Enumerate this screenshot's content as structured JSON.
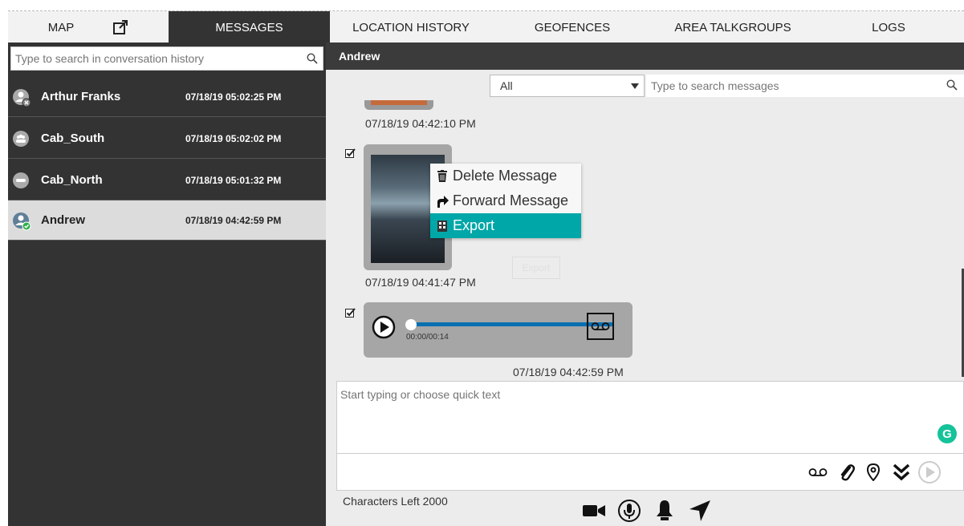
{
  "tabs": {
    "map": "MAP",
    "messages": "MESSAGES",
    "location_history": "LOCATION HISTORY",
    "geofences": "GEOFENCES",
    "area_talkgroups": "AREA TALKGROUPS",
    "logs": "LOGS"
  },
  "sidebar": {
    "search_placeholder": "Type to search in conversation history",
    "conversations": [
      {
        "name": "Arthur Franks",
        "time": "07/18/19 05:02:25 PM"
      },
      {
        "name": "Cab_South",
        "time": "07/18/19 05:02:02 PM"
      },
      {
        "name": "Cab_North",
        "time": "07/18/19 05:01:32 PM"
      },
      {
        "name": "Andrew",
        "time": "07/18/19 04:42:59 PM"
      }
    ]
  },
  "conversation": {
    "title": "Andrew",
    "filter_value": "All",
    "search_placeholder": "Type to search messages",
    "messages": [
      {
        "time": "07/18/19 04:42:10 PM"
      },
      {
        "time": "07/18/19 04:41:47 PM",
        "ghost_label": "Export"
      },
      {
        "time": "07/18/19 04:42:59 PM",
        "duration": "00:00/00:14"
      }
    ],
    "context_menu": [
      "Delete Message",
      "Forward Message",
      "Export"
    ],
    "compose_placeholder": "Start typing or choose quick text",
    "chars_left": "Characters Left 2000"
  },
  "colors": {
    "accent": "#00a7a8",
    "dark_panel": "#333333",
    "progress": "#0a6fb0"
  }
}
